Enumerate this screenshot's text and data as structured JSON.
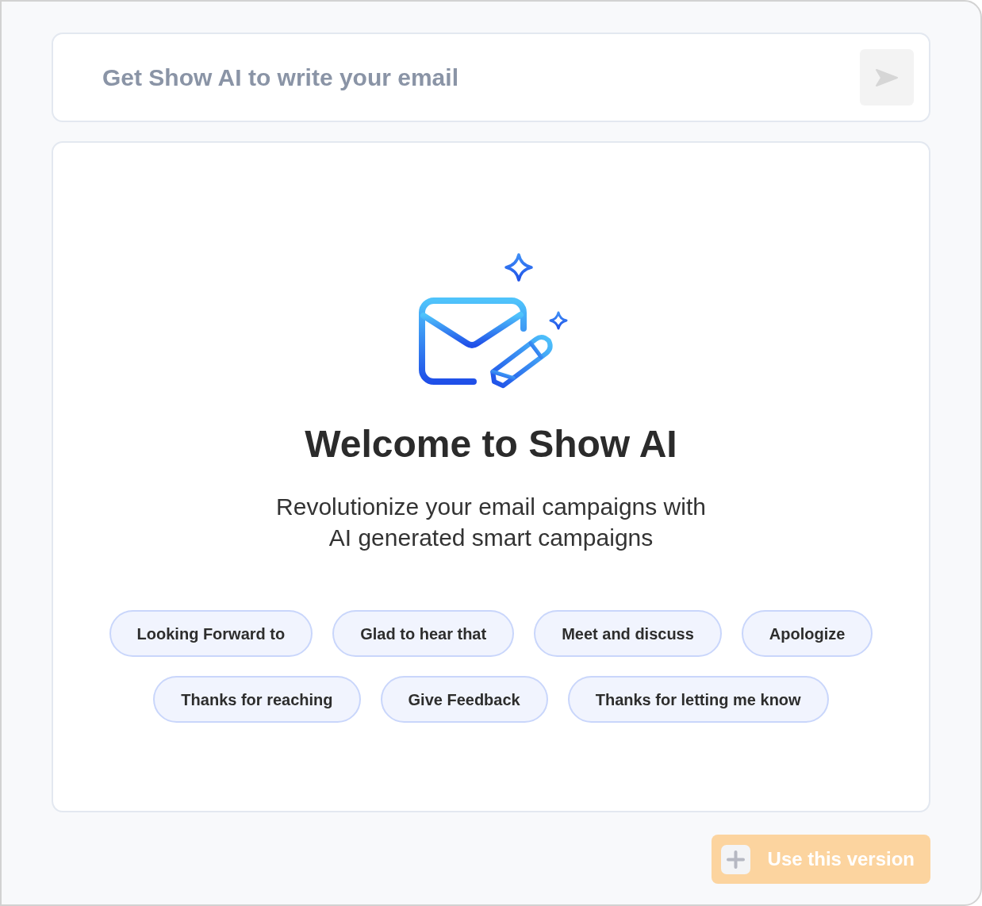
{
  "prompt_bar": {
    "placeholder": "Get Show AI to write your email",
    "send_button": {
      "disabled": true
    }
  },
  "welcome": {
    "title": "Welcome to Show AI",
    "subtitle": "Revolutionize your email campaigns with\nAI generated smart campaigns"
  },
  "suggestions": [
    "Looking Forward to",
    "Glad to hear that",
    "Meet and discuss",
    "Apologize",
    "Thanks for reaching",
    "Give Feedback",
    "Thanks for letting me know"
  ],
  "use_version_button": {
    "label": "Use this version",
    "disabled": true
  }
}
